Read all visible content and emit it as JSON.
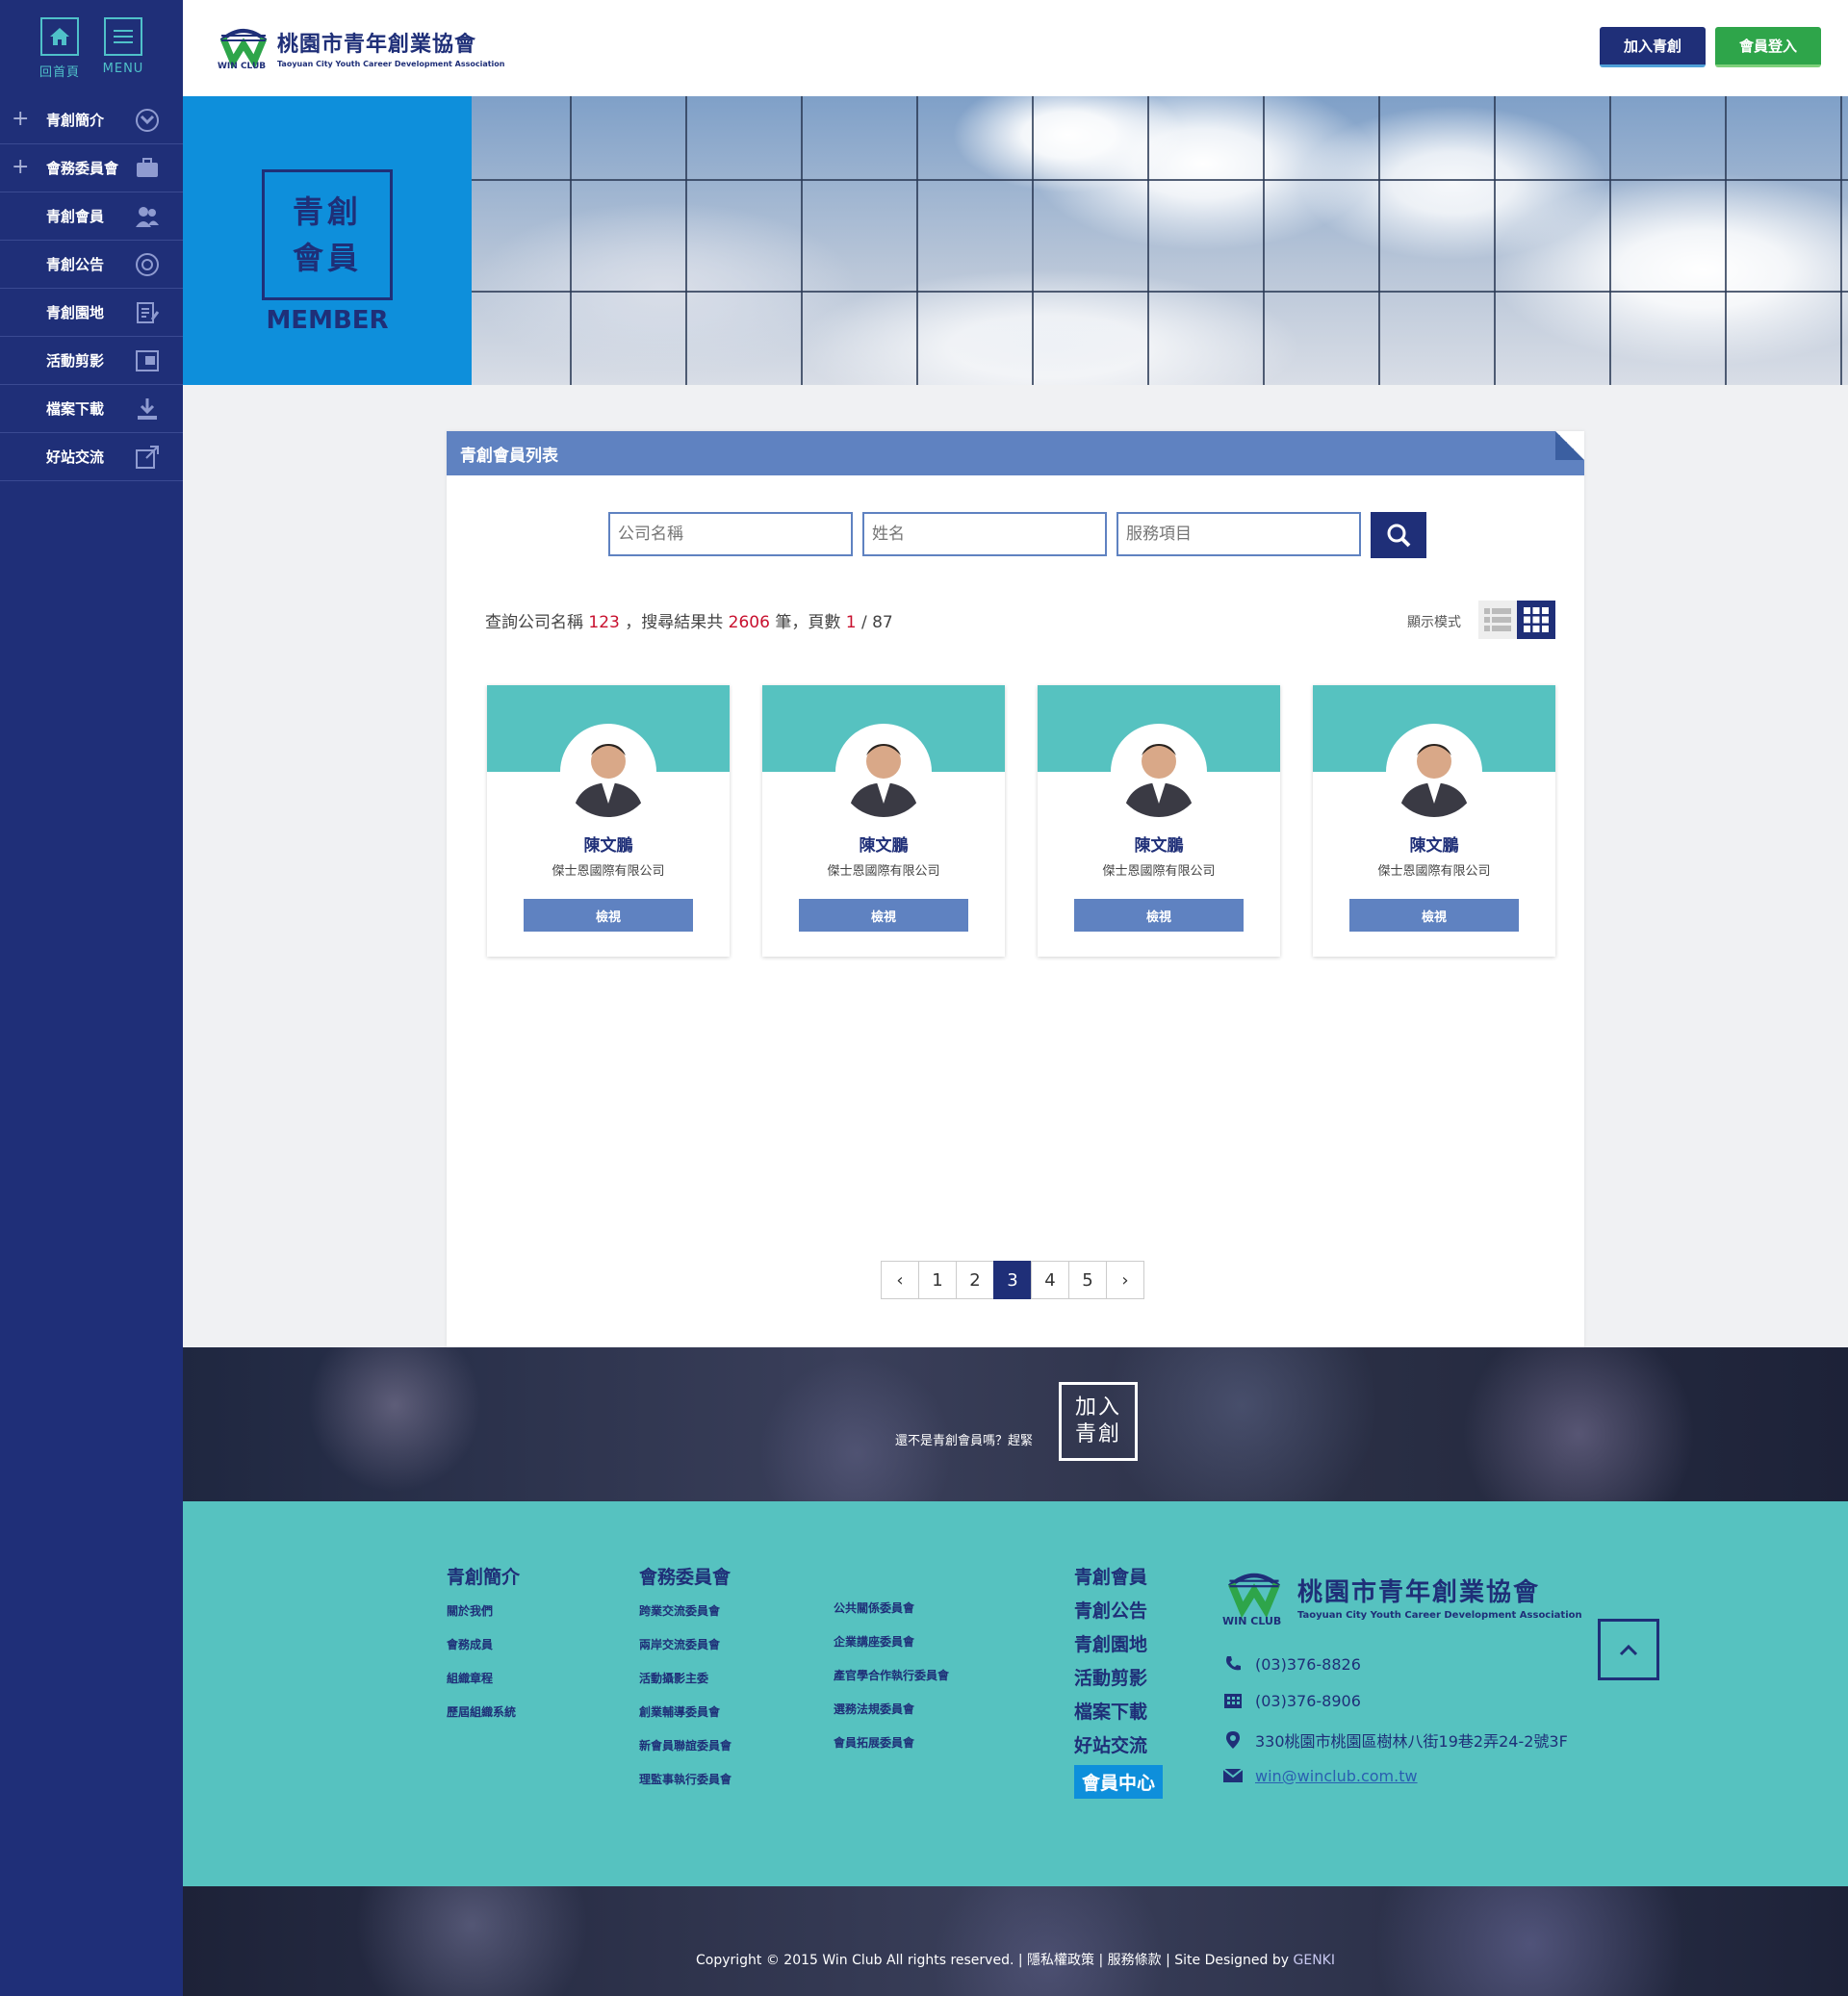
{
  "sidebar": {
    "home_label": "回首頁",
    "menu_label": "MENU",
    "items": [
      {
        "label": "青創簡介",
        "has_plus": true,
        "icon": "handshake-icon"
      },
      {
        "label": "會務委員會",
        "has_plus": true,
        "icon": "briefcase-icon"
      },
      {
        "label": "青創會員",
        "has_plus": false,
        "icon": "people-icon"
      },
      {
        "label": "青創公告",
        "has_plus": false,
        "icon": "lifebuoy-icon"
      },
      {
        "label": "青創園地",
        "has_plus": false,
        "icon": "document-edit-icon"
      },
      {
        "label": "活動剪影",
        "has_plus": false,
        "icon": "photo-icon"
      },
      {
        "label": "檔案下載",
        "has_plus": false,
        "icon": "download-icon"
      },
      {
        "label": "好站交流",
        "has_plus": false,
        "icon": "external-link-icon"
      }
    ]
  },
  "header": {
    "logo_cn": "桃園市青年創業協會",
    "logo_en": "Taoyuan City Youth Career Development Association",
    "logo_badge": "WIN CLUB",
    "join_label": "加入青創",
    "login_label": "會員登入"
  },
  "banner": {
    "title_line1": "青創",
    "title_line2": "會員",
    "subtitle": "MEMBER"
  },
  "panel": {
    "title": "青創會員列表",
    "search": {
      "company_placeholder": "公司名稱",
      "name_placeholder": "姓名",
      "service_placeholder": "服務項目"
    },
    "result": {
      "prefix": "查詢公司名稱",
      "query": "123",
      "mid": "，搜尋結果共",
      "total": "2606",
      "unit": "筆，頁數",
      "page": "1",
      "pages_sep": "/ 87"
    },
    "view_mode_label": "顯示模式",
    "cards": [
      {
        "name": "陳文鵬",
        "company": "傑士恩國際有限公司",
        "button": "檢視"
      },
      {
        "name": "陳文鵬",
        "company": "傑士恩國際有限公司",
        "button": "檢視"
      },
      {
        "name": "陳文鵬",
        "company": "傑士恩國際有限公司",
        "button": "檢視"
      },
      {
        "name": "陳文鵬",
        "company": "傑士恩國際有限公司",
        "button": "檢視"
      }
    ],
    "pager": {
      "prev": "‹",
      "pages": [
        "1",
        "2",
        "3",
        "4",
        "5"
      ],
      "active": "3",
      "next": "›"
    }
  },
  "cta": {
    "text": "還不是青創會員嗎？趕緊",
    "button_line1": "加入",
    "button_line2": "青創"
  },
  "footer": {
    "col1": {
      "heading": "青創簡介",
      "links": [
        "關於我們",
        "會務成員",
        "組織章程",
        "歷屆組織系統"
      ]
    },
    "col2": {
      "heading": "會務委員會",
      "links": [
        "跨業交流委員會",
        "兩岸交流委員會",
        "活動攝影主委",
        "創業輔導委員會",
        "新會員聯誼委員會",
        "理監事執行委員會"
      ]
    },
    "col3": {
      "links": [
        "公共關係委員會",
        "企業講座委員會",
        "產官學合作執行委員會",
        "選務法規委員會",
        "會員拓展委員會"
      ]
    },
    "col4": {
      "links": [
        "青創會員",
        "青創公告",
        "青創園地",
        "活動剪影",
        "檔案下載",
        "好站交流"
      ],
      "member_center": "會員中心"
    },
    "logo_cn": "桃園市青年創業協會",
    "logo_en": "Taoyuan City Youth Career Development Association",
    "logo_badge": "WIN CLUB",
    "phone": "(03)376-8826",
    "fax": "(03)376-8906",
    "address": "330桃園市桃園區樹林八街19巷2弄24-2號3F",
    "email": "win@winclub.com.tw"
  },
  "copyright": {
    "text": "Copyright © 2015 Win Club  All rights reserved.  |  隱私權政策  |  服務條款  |  Site Designed by ",
    "brand": "GENKI"
  },
  "colors": {
    "navy": "#1f2f78",
    "teal": "#56c2c0",
    "blue": "#0e8fdb",
    "panel_blue": "#5f82c1",
    "green": "#2ea54a",
    "red": "#c8102e"
  }
}
